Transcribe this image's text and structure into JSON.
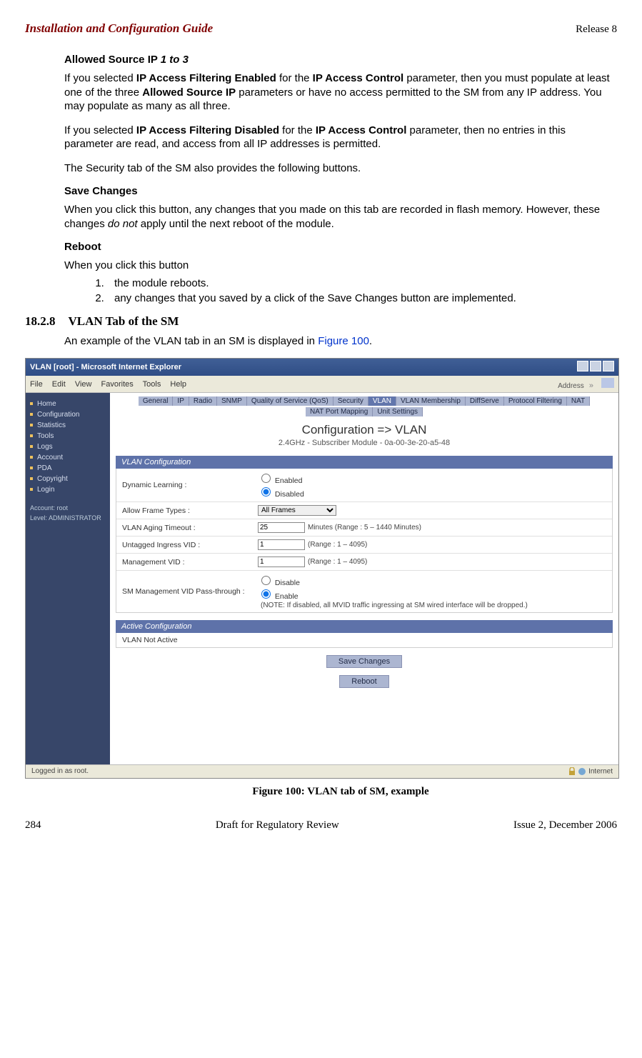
{
  "header": {
    "left": "Installation and Configuration Guide",
    "right": "Release 8"
  },
  "footer": {
    "left": "284",
    "center": "Draft for Regulatory Review",
    "right": "Issue 2, December 2006"
  },
  "sec1": {
    "title_a": "Allowed Source IP ",
    "title_b": "1 to 3",
    "p1_a": "If you selected ",
    "p1_b": "IP Access Filtering Enabled",
    "p1_c": " for the ",
    "p1_d": "IP Access Control",
    "p1_e": " parameter, then you must populate at least one of the three ",
    "p1_f": "Allowed Source IP",
    "p1_g": " parameters or have no access permitted to the SM from any IP address. You may populate as many as all three.",
    "p2_a": "If you selected ",
    "p2_b": "IP Access Filtering Disabled",
    "p2_c": " for the ",
    "p2_d": "IP Access Control",
    "p2_e": " parameter, then no entries in this parameter are read, and access from all IP addresses is permitted.",
    "p3": "The Security tab of the SM also provides the following buttons."
  },
  "sec2": {
    "title": "Save Changes",
    "p": "When you click this button, any changes that you made on this tab are recorded in flash memory. However, these changes ",
    "p_it": "do not",
    "p_end": " apply until the next reboot of the module."
  },
  "sec3": {
    "title": "Reboot",
    "p": "When you click this button",
    "li1": "the module reboots.",
    "li2a": "any changes that you saved by a click of the ",
    "li2b": "Save Changes",
    "li2c": " button are implemented."
  },
  "sec4": {
    "num": "18.2.8",
    "title": "VLAN Tab of the SM",
    "intro_a": "An example of the VLAN tab in an SM is displayed in ",
    "intro_link": "Figure 100",
    "intro_b": "."
  },
  "screenshot": {
    "title": "VLAN [root] - Microsoft Internet Explorer",
    "menu": [
      "File",
      "Edit",
      "View",
      "Favorites",
      "Tools",
      "Help"
    ],
    "addr_label": "Address",
    "sidebar": [
      "Home",
      "Configuration",
      "Statistics",
      "Tools",
      "Logs",
      "Account",
      "PDA",
      "Copyright",
      "Login"
    ],
    "account_line1": "Account: root",
    "account_line2": "Level: ADMINISTRATOR",
    "tabs_row1": [
      "General",
      "IP",
      "Radio",
      "SNMP",
      "Quality of Service (QoS)",
      "Security",
      "VLAN",
      "VLAN Membership",
      "DiffServe",
      "Protocol Filtering",
      "NAT",
      "NAT Port Mapping",
      "Unit Settings"
    ],
    "page_title": "Configuration => VLAN",
    "page_sub": "2.4GHz - Subscriber Module - 0a-00-3e-20-a5-48",
    "panel1": "VLAN Configuration",
    "row1_label": "Dynamic Learning :",
    "row1_opt1": "Enabled",
    "row1_opt2": "Disabled",
    "row2_label": "Allow Frame Types :",
    "row2_value": "All Frames",
    "row3_label": "VLAN Aging Timeout :",
    "row3_value": "25",
    "row3_hint": "Minutes (Range : 5 – 1440 Minutes)",
    "row4_label": "Untagged Ingress VID :",
    "row4_value": "1",
    "row4_hint": "(Range : 1 – 4095)",
    "row5_label": "Management VID :",
    "row5_value": "1",
    "row5_hint": "(Range : 1 – 4095)",
    "row6_label": "SM Management VID Pass-through :",
    "row6_opt1": "Disable",
    "row6_opt2": "Enable",
    "row6_note": "(NOTE: If disabled, all MVID traffic ingressing at SM wired interface will be dropped.)",
    "panel2": "Active Configuration",
    "panel2_body": "VLAN Not Active",
    "btn_save": "Save Changes",
    "btn_reboot": "Reboot",
    "status_left": "Logged in as root.",
    "status_right": "Internet"
  },
  "caption": "Figure 100: VLAN tab of SM, example"
}
